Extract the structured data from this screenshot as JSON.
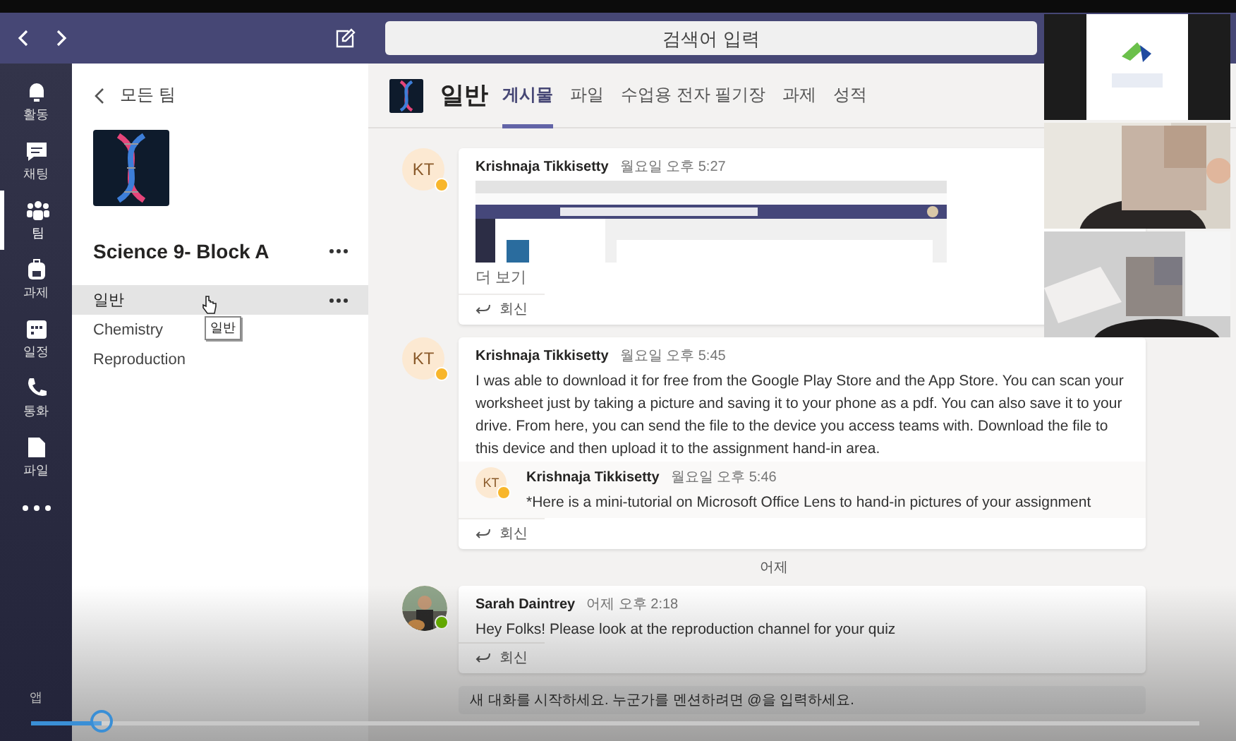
{
  "top_bar": {
    "search_placeholder": "검색어 입력"
  },
  "rail": [
    {
      "label": "활동",
      "selected": false
    },
    {
      "label": "채팅",
      "selected": false
    },
    {
      "label": "팀",
      "selected": true
    },
    {
      "label": "과제",
      "selected": false
    },
    {
      "label": "일정",
      "selected": false
    },
    {
      "label": "통화",
      "selected": false
    },
    {
      "label": "파일",
      "selected": false
    }
  ],
  "rail_bottom": {
    "label": "앱"
  },
  "team_panel": {
    "back_label": "모든 팀",
    "team_name": "Science 9- Block A",
    "tooltip": "일반",
    "channels": [
      {
        "name": "일반",
        "selected": true
      },
      {
        "name": "Chemistry",
        "selected": false
      },
      {
        "name": "Reproduction",
        "selected": false
      }
    ]
  },
  "channel_header": {
    "name": "일반",
    "tabs": [
      {
        "label": "게시물",
        "selected": true
      },
      {
        "label": "파일",
        "selected": false
      },
      {
        "label": "수업용 전자 필기장",
        "selected": false
      },
      {
        "label": "과제",
        "selected": false
      },
      {
        "label": "성적",
        "selected": false
      }
    ]
  },
  "feed": [
    {
      "kind": "post",
      "initials": "KT",
      "color": "#f8b62b",
      "author": "Krishnaja Tikkisetty",
      "time": "월요일 오후 5:27",
      "more": "더 보기",
      "reply": "회신"
    },
    {
      "kind": "post",
      "initials": "KT",
      "color": "#f8b62b",
      "author": "Krishnaja Tikkisetty",
      "time": "월요일 오후 5:45",
      "body": "I was able to download it for free from the Google Play Store and the App Store. You can scan your worksheet just by taking a picture and saving it to your phone as a pdf. You can also save it to your drive. From here, you can send the file to the device you access teams with. Download the file to this device and then upload it to the assignment hand-in area.",
      "replies": [
        {
          "initials": "KT",
          "color": "#f8b62b",
          "author": "Krishnaja Tikkisetty",
          "time": "월요일 오후 5:46",
          "body": "*Here is a mini-tutorial on Microsoft Office Lens to hand-in pictures of your assignment"
        }
      ],
      "reply": "회신"
    },
    {
      "kind": "divider",
      "label": "어제"
    },
    {
      "kind": "post",
      "color": "#6bb700",
      "author": "Sarah Daintrey",
      "time": "어제 오후 2:18",
      "body": "Hey Folks! Please look at the reproduction channel for your quiz",
      "reply": "회신"
    }
  ],
  "composer": {
    "placeholder": "새 대화를 시작하세요. 누군가를 멘션하려면 @을 입력하세요."
  },
  "video_player": {
    "level": 0.06
  }
}
